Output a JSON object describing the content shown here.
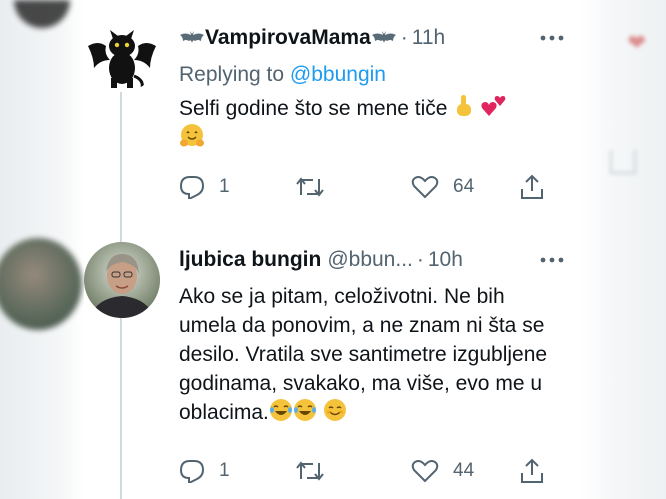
{
  "tweets": [
    {
      "display_name": "VampirovaMama",
      "name_emoji": "bat-icon",
      "time": "11h",
      "reply_prefix": "Replying to",
      "reply_to": "@bbungin",
      "text": "Selfi godine što se mene tiče",
      "text_emoji": [
        "pointing-up-hand-icon",
        "two-hearts-icon"
      ],
      "text_line2_emoji": "hugging-face-icon",
      "replies": "1",
      "retweets": "",
      "likes": "64",
      "more": "···"
    },
    {
      "display_name": "ljubica bungin",
      "handle": "@bbun...",
      "time": "10h",
      "text": "Ako se ja pitam, celoživotni. Ne bih umela da ponovim, a ne znam ni šta se desilo. Vratila sve santimetre izgubljene godinama, svakako, ma više, evo me u oblacima.",
      "text_emoji": [
        "joy-icon",
        "joy-icon",
        "smiling-face-icon"
      ],
      "replies": "1",
      "retweets": "",
      "likes": "44",
      "more": "···"
    }
  ],
  "colors": {
    "text": "#0f1419",
    "secondary": "#536471",
    "link": "#1d9bf0",
    "thread_line": "#cfd9de"
  }
}
